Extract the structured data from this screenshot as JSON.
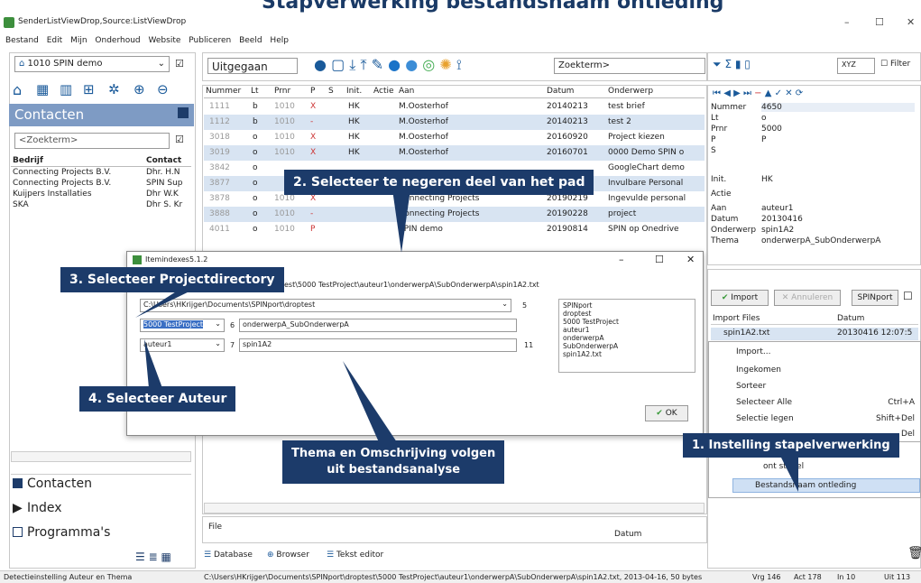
{
  "banner": {
    "title": "Stapverwerking bestandsnaam ontleding"
  },
  "window": {
    "title": "SenderListViewDrop,Source:ListViewDrop",
    "minimize": "–",
    "maximize": "☐",
    "close": "✕"
  },
  "menu": [
    "Bestand",
    "Edit",
    "Mijn",
    "Onderhoud",
    "Website",
    "Publiceren",
    "Beeld",
    "Help"
  ],
  "left": {
    "db_select": "1010 SPIN demo",
    "section_title": "Contacten",
    "filter_placeholder": "<Zoekterm>",
    "columns": [
      "Bedrijf",
      "Contact"
    ],
    "rows": [
      [
        "Connecting Projects B.V.",
        "Dhr. H.N"
      ],
      [
        "Connecting Projects B.V.",
        "SPIN Sup"
      ],
      [
        "Kuijpers Installaties",
        "Dhr W.K"
      ],
      [
        "SKA",
        "Dhr S. Kr"
      ]
    ],
    "nav": [
      "Contacten",
      "Index",
      "Programma's"
    ]
  },
  "toolbar": {
    "folder": "Uitgegaan",
    "search_placeholder": "Zoekterm>",
    "xyz": "XYZ",
    "filter_label": "Filter"
  },
  "grid": {
    "columns": [
      "Nummer",
      "Lt",
      "Prnr",
      "P",
      "S",
      "Init.",
      "Actie",
      "Aan",
      "Datum",
      "Onderwerp"
    ],
    "rows": [
      [
        "1111",
        "b",
        "1010",
        "X",
        "",
        "HK",
        "",
        "M.Oosterhof",
        "20140213",
        "test brief"
      ],
      [
        "1112",
        "b",
        "1010",
        "-",
        "",
        "HK",
        "",
        "M.Oosterhof",
        "20140213",
        "test 2"
      ],
      [
        "3018",
        "o",
        "1010",
        "X",
        "",
        "HK",
        "",
        "M.Oosterhof",
        "20160920",
        "Project kiezen"
      ],
      [
        "3019",
        "o",
        "1010",
        "X",
        "",
        "HK",
        "",
        "M.Oosterhof",
        "20160701",
        "0000 Demo SPIN o"
      ],
      [
        "3842",
        "o",
        "",
        "",
        "",
        "",
        "",
        "",
        "",
        "GoogleChart demo"
      ],
      [
        "3877",
        "o",
        "",
        "",
        "",
        "",
        "",
        "",
        "",
        "Invulbare Personal"
      ],
      [
        "3878",
        "o",
        "1010",
        "X",
        "",
        "",
        "",
        "Connecting Projects",
        "20190219",
        "Ingevulde personal"
      ],
      [
        "3888",
        "o",
        "1010",
        "-",
        "",
        "",
        "",
        "Connecting Projects",
        "20190228",
        "project"
      ],
      [
        "4011",
        "o",
        "1010",
        "P",
        "",
        "",
        "",
        "SPIN demo",
        "20190814",
        "SPIN op Onedrive"
      ]
    ],
    "footer_file": "File",
    "footer_datum": "Datum"
  },
  "bottom_tabs": [
    "Database",
    "Browser",
    "Tekst editor"
  ],
  "detail": {
    "fields": [
      [
        "Nummer",
        "4650"
      ],
      [
        "Lt",
        "o"
      ],
      [
        "Prnr",
        "5000"
      ],
      [
        "P",
        "P"
      ],
      [
        "S",
        ""
      ],
      [
        "Init.",
        "HK"
      ],
      [
        "Actie",
        ""
      ],
      [
        "Aan",
        "auteur1"
      ],
      [
        "Datum",
        "20130416"
      ],
      [
        "Onderwerp",
        "spin1A2"
      ],
      [
        "Thema",
        "onderwerpA_SubOnderwerpA"
      ]
    ]
  },
  "import": {
    "import_btn": "Import",
    "cancel_btn": "Annuleren",
    "spinport_btn": "SPINport",
    "col_files": "Import Files",
    "col_date": "Datum",
    "file": "spin1A2.txt",
    "file_date": "20130416 12:07:5"
  },
  "context_menu": [
    {
      "label": "Import...",
      "shortcut": ""
    },
    {
      "label": "Ingekomen",
      "shortcut": ""
    },
    {
      "label": "Sorteer",
      "shortcut": ""
    },
    {
      "label": "Selecteer Alle",
      "shortcut": "Ctrl+A"
    },
    {
      "label": "Selectie legen",
      "shortcut": "Shift+Del"
    },
    {
      "label": "Del",
      "shortcut": ""
    },
    {
      "label": "ont stapel",
      "shortcut": ""
    },
    {
      "label": "Bestandsnaam ontleding",
      "shortcut": ""
    }
  ],
  "dialog": {
    "title": "Itemindexes5.1.2",
    "path": "C:\\Users\\HKrijger\\Documents\\SPINport\\droptest",
    "path_full": "\\droptest\\5000 TestProject\\auteur1\\onderwerpA\\SubOnderwerpA\\spin1A2.txt",
    "num5": "5",
    "project": "5000 TestProject",
    "num6": "6",
    "theme": "onderwerpA_SubOnderwerpA",
    "author": "auteur1",
    "num7": "7",
    "subject": "spin1A2",
    "num11": "11",
    "parts": [
      "SPINport",
      "droptest",
      "5000 TestProject",
      "auteur1",
      "onderwerpA",
      "SubOnderwerpA",
      "spin1A2.txt"
    ],
    "ok": "OK"
  },
  "callouts": {
    "c1": "1. Instelling stapelverwerking",
    "c2": "2. Selecteer te negeren deel van het pad",
    "c3": "3. Selecteer Projectdirectory",
    "c4": "4. Selecteer Auteur",
    "c5a": "Thema en Omschrijving volgen",
    "c5b": "uit bestandsanalyse"
  },
  "status": {
    "left": "Detectieinstelling Auteur en Thema",
    "path": "C:\\Users\\HKrijger\\Documents\\SPINport\\droptest\\5000 TestProject\\auteur1\\onderwerpA\\SubOnderwerpA\\spin1A2.txt, 2013-04-16, 50 bytes",
    "vrg": "Vrg 146",
    "act": "Act 178",
    "in": "In 10",
    "uit": "Uit 113"
  }
}
